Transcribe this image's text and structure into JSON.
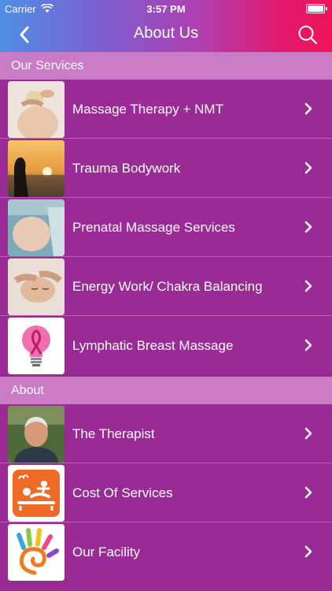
{
  "status": {
    "carrier": "Carrier",
    "time": "3:57 PM"
  },
  "nav": {
    "title": "About Us",
    "back_icon": "chevron-left-icon",
    "search_icon": "search-icon"
  },
  "sections": [
    {
      "header": "Our Services",
      "items": [
        {
          "label": "Massage Therapy + NMT",
          "thumb": "massage-photo"
        },
        {
          "label": "Trauma Bodywork",
          "thumb": "sunset-silhouette-photo"
        },
        {
          "label": "Prenatal Massage Services",
          "thumb": "pregnant-belly-photo"
        },
        {
          "label": "Energy Work/ Chakra Balancing",
          "thumb": "face-massage-photo"
        },
        {
          "label": "Lymphatic Breast Massage",
          "thumb": "pink-ribbon-bulb-icon"
        }
      ]
    },
    {
      "header": "About",
      "items": [
        {
          "label": "The Therapist",
          "thumb": "therapist-portrait-photo"
        },
        {
          "label": "Cost Of Services",
          "thumb": "massage-table-icon"
        },
        {
          "label": "Our Facility",
          "thumb": "spiral-hand-logo"
        }
      ]
    }
  ],
  "colors": {
    "list_bg": "#9a2a96",
    "section_header_bg": "#c97bc6",
    "divider": "#b85fb4"
  }
}
